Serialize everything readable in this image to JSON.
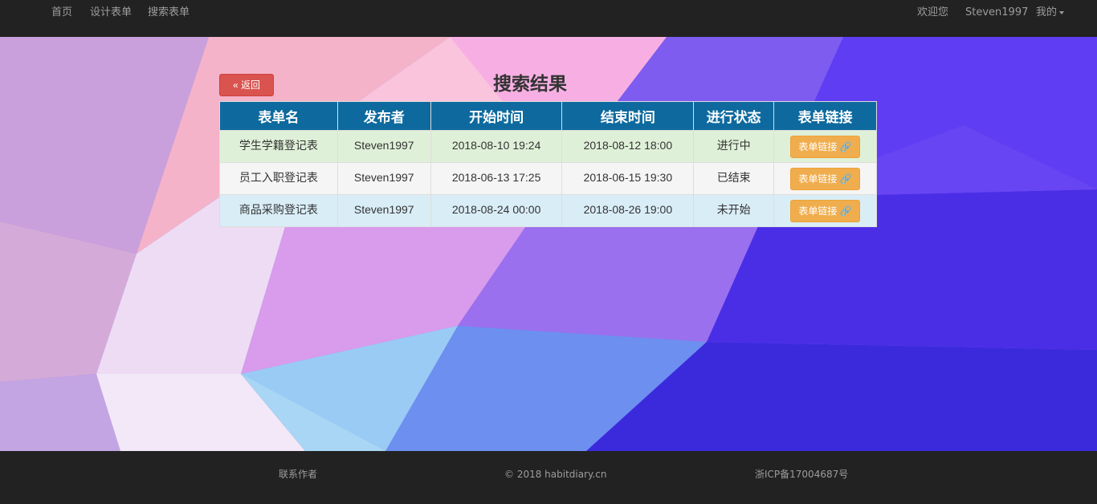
{
  "navbar": {
    "left_links": [
      "首页",
      "设计表单",
      "搜索表单"
    ],
    "welcome": "欢迎您",
    "username": "Steven1997",
    "mine_menu": "我的"
  },
  "page": {
    "back_button": "« 返回",
    "title": "搜索结果"
  },
  "table": {
    "headers": [
      "表单名",
      "发布者",
      "开始时间",
      "结束时间",
      "进行状态",
      "表单链接"
    ],
    "rows": [
      {
        "name": "学生学籍登记表",
        "publisher": "Steven1997",
        "start": "2018-08-10 19:24",
        "end": "2018-08-12 18:00",
        "status": "进行中",
        "link": "表单链接"
      },
      {
        "name": "员工入职登记表",
        "publisher": "Steven1997",
        "start": "2018-06-13 17:25",
        "end": "2018-06-15 19:30",
        "status": "已结束",
        "link": "表单链接"
      },
      {
        "name": "商品采购登记表",
        "publisher": "Steven1997",
        "start": "2018-08-24 00:00",
        "end": "2018-08-26 19:00",
        "status": "未开始",
        "link": "表单链接"
      }
    ]
  },
  "footer": {
    "contact": "联系作者",
    "copyright": "© 2018 habitdiary.cn",
    "icp": "浙ICP备17004687号"
  },
  "colors": {
    "navbar_bg": "#222222",
    "header_bg": "#0e6a9e",
    "back_button": "#d9534f",
    "link_button": "#f0ad4e"
  },
  "icons": {
    "link_icon": "link-icon",
    "caret": "caret-down-icon"
  }
}
